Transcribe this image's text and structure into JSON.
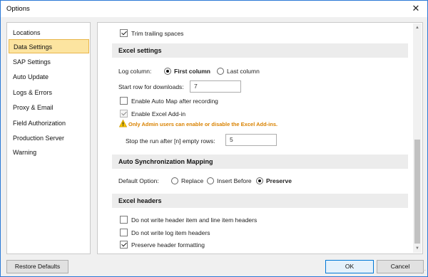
{
  "window": {
    "title": "Options",
    "close_icon": "close-icon"
  },
  "sidebar": {
    "items": [
      {
        "label": "Locations"
      },
      {
        "label": "Data Settings"
      },
      {
        "label": "SAP Settings"
      },
      {
        "label": "Auto Update"
      },
      {
        "label": "Logs & Errors"
      },
      {
        "label": "Proxy & Email"
      },
      {
        "label": "Field Authorization"
      },
      {
        "label": "Production Server Warning"
      }
    ],
    "active": "Data Settings"
  },
  "main": {
    "trim_trailing": {
      "label": "Trim trailing spaces",
      "checked": true
    },
    "excel_settings": {
      "header": "Excel settings",
      "log_column_label": "Log column:",
      "log_column_options": [
        "First column",
        "Last column"
      ],
      "log_column_selected": "First column",
      "start_row_label": "Start row for downloads:",
      "start_row_value": "7",
      "enable_auto_map": {
        "label": "Enable Auto Map after recording",
        "checked": false
      },
      "enable_excel_addin": {
        "label": "Enable Excel Add-in",
        "checked": true,
        "disabled": true
      },
      "warning": "Only Admin users can enable or disable the Excel Add-ins.",
      "stop_run_label": "Stop the run after [n] empty rows:",
      "stop_run_value": "5"
    },
    "auto_sync": {
      "header": "Auto Synchronization Mapping",
      "default_option_label": "Default Option:",
      "options": [
        "Replace",
        "Insert Before",
        "Preserve"
      ],
      "selected": "Preserve"
    },
    "excel_headers": {
      "header": "Excel headers",
      "no_header_item": {
        "label": "Do not write header item and line item headers",
        "checked": false
      },
      "no_log_item": {
        "label": "Do not write log item headers",
        "checked": false
      },
      "preserve_formatting": {
        "label": "Preserve header formatting",
        "checked": true
      }
    }
  },
  "footer": {
    "restore_defaults": "Restore Defaults",
    "ok": "OK",
    "cancel": "Cancel"
  },
  "colors": {
    "accent": "#2b79d6",
    "active_item_bg": "#fce4a0",
    "warning": "#d98200"
  }
}
